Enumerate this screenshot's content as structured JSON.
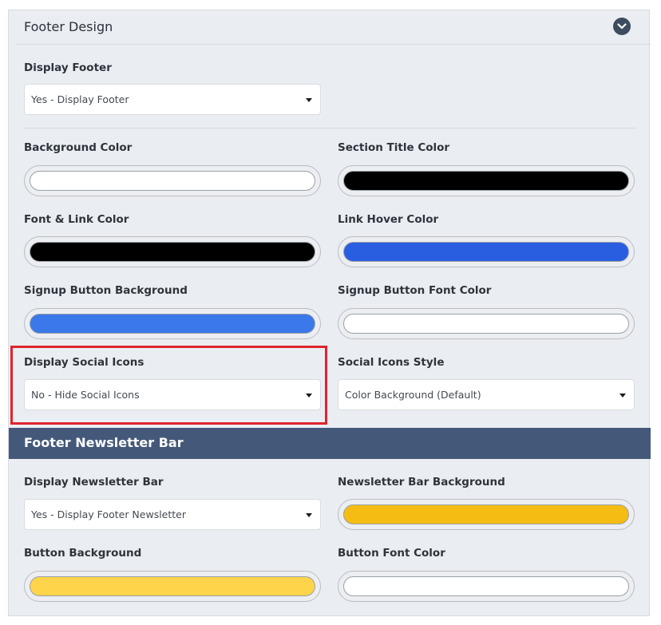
{
  "footer_design": {
    "title": "Footer Design",
    "display_footer": {
      "label": "Display Footer",
      "value": "Yes - Display Footer"
    },
    "background_color": {
      "label": "Background Color",
      "color": "#ffffff"
    },
    "section_title_color": {
      "label": "Section Title Color",
      "color": "#000000"
    },
    "font_link_color": {
      "label": "Font & Link Color",
      "color": "#000000"
    },
    "link_hover_color": {
      "label": "Link Hover Color",
      "color": "#2a5ee0"
    },
    "signup_button_background": {
      "label": "Signup Button Background",
      "color": "#3b78ea"
    },
    "signup_button_font_color": {
      "label": "Signup Button Font Color",
      "color": "#ffffff"
    },
    "display_social_icons": {
      "label": "Display Social Icons",
      "value": "No - Hide Social Icons"
    },
    "social_icons_style": {
      "label": "Social Icons Style",
      "value": "Color Background (Default)"
    }
  },
  "footer_newsletter": {
    "title": "Footer Newsletter Bar",
    "display_newsletter_bar": {
      "label": "Display Newsletter Bar",
      "value": "Yes - Display Footer Newsletter"
    },
    "newsletter_bar_background": {
      "label": "Newsletter Bar Background",
      "color": "#f5bd14"
    },
    "button_background": {
      "label": "Button Background",
      "color": "#fdd44a"
    },
    "button_font_color": {
      "label": "Button Font Color",
      "color": "#ffffff"
    }
  },
  "colors": {
    "section_bar": "#44597a",
    "highlight_border": "#e0242c",
    "panel_background": "#eaedf2"
  }
}
